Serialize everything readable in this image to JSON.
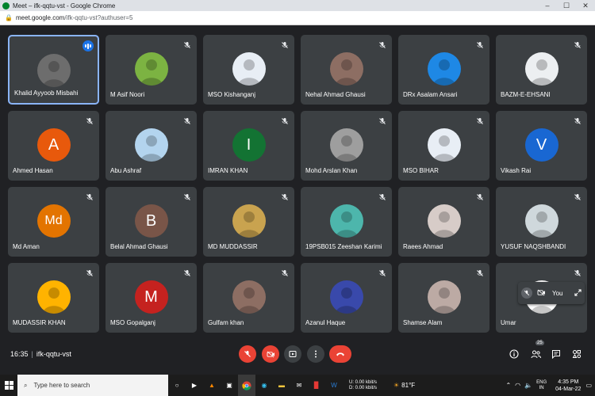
{
  "browser": {
    "window_title": "Meet – ifk-qqtu-vst - Google Chrome",
    "url_host": "meet.google.com",
    "url_path": "/ifk-qqtu-vst?authuser=5"
  },
  "participants": [
    {
      "name": "Khalid Ayyoob Misbahi",
      "avatar": "photo",
      "color": "#6d6d6d",
      "speaking": true
    },
    {
      "name": "M Asif Noori",
      "avatar": "photo",
      "color": "#7cb342"
    },
    {
      "name": "MSO Kishanganj",
      "avatar": "photo",
      "color": "#e8eef5"
    },
    {
      "name": "Nehal Ahmad Ghausi",
      "avatar": "photo",
      "color": "#8d6e63"
    },
    {
      "name": "DRx Asalam Ansari",
      "avatar": "photo",
      "color": "#1e88e5"
    },
    {
      "name": "BAZM-E-EHSANI",
      "avatar": "photo",
      "color": "#eceff1"
    },
    {
      "name": "Ahmed Hasan",
      "avatar": "A",
      "color": "#e8590c"
    },
    {
      "name": "Abu Ashraf",
      "avatar": "photo",
      "color": "#b3d4ee"
    },
    {
      "name": "IMRAN KHAN",
      "avatar": "I",
      "color": "#137333"
    },
    {
      "name": "Mohd Arslan Khan",
      "avatar": "photo",
      "color": "#9e9e9e"
    },
    {
      "name": "MSO BIHAR",
      "avatar": "photo",
      "color": "#e8eef5"
    },
    {
      "name": "Vikash Rai",
      "avatar": "V",
      "color": "#1967d2"
    },
    {
      "name": "Md Aman",
      "avatar": "Md",
      "color": "#e37400"
    },
    {
      "name": "Belal Ahmad Ghausi",
      "avatar": "B",
      "color": "#795548"
    },
    {
      "name": "MD MUDDASSIR",
      "avatar": "photo",
      "color": "#c9a34f"
    },
    {
      "name": "19PSB015 Zeeshan Karimi",
      "avatar": "photo",
      "color": "#4db6ac"
    },
    {
      "name": "Raees Ahmad",
      "avatar": "photo",
      "color": "#d7ccc8"
    },
    {
      "name": "YUSUF NAQSHBANDI",
      "avatar": "photo",
      "color": "#cfd8dc"
    },
    {
      "name": "MUDASSIR KHAN",
      "avatar": "photo",
      "color": "#ffb300"
    },
    {
      "name": "MSO Gopalganj",
      "avatar": "M",
      "color": "#c5221f"
    },
    {
      "name": "Gulfam khan",
      "avatar": "photo",
      "color": "#8d6e63"
    },
    {
      "name": "Azanul Haque",
      "avatar": "photo",
      "color": "#3949ab"
    },
    {
      "name": "Shamse Alam",
      "avatar": "photo",
      "color": "#bcaaa4"
    },
    {
      "name": "Umar",
      "avatar": "photo",
      "color": "#ffffff"
    }
  ],
  "self_view": {
    "label": "You"
  },
  "meeting": {
    "time": "16:35",
    "code": "ifk-qqtu-vst",
    "participant_count": "25"
  },
  "taskbar": {
    "search_placeholder": "Type here to search",
    "net_up": "0.00 kbit/s",
    "net_down": "0.00 kbit/s",
    "net_up_label": "U:",
    "net_down_label": "D:",
    "temperature": "81°F",
    "lang_1": "ENG",
    "lang_2": "IN",
    "clock_time": "4:35 PM",
    "clock_date": "04-Mar-22"
  },
  "colors": {
    "accent": "#8ab4f8",
    "danger": "#ea4335",
    "tile": "#3c4043",
    "background": "#202124"
  }
}
